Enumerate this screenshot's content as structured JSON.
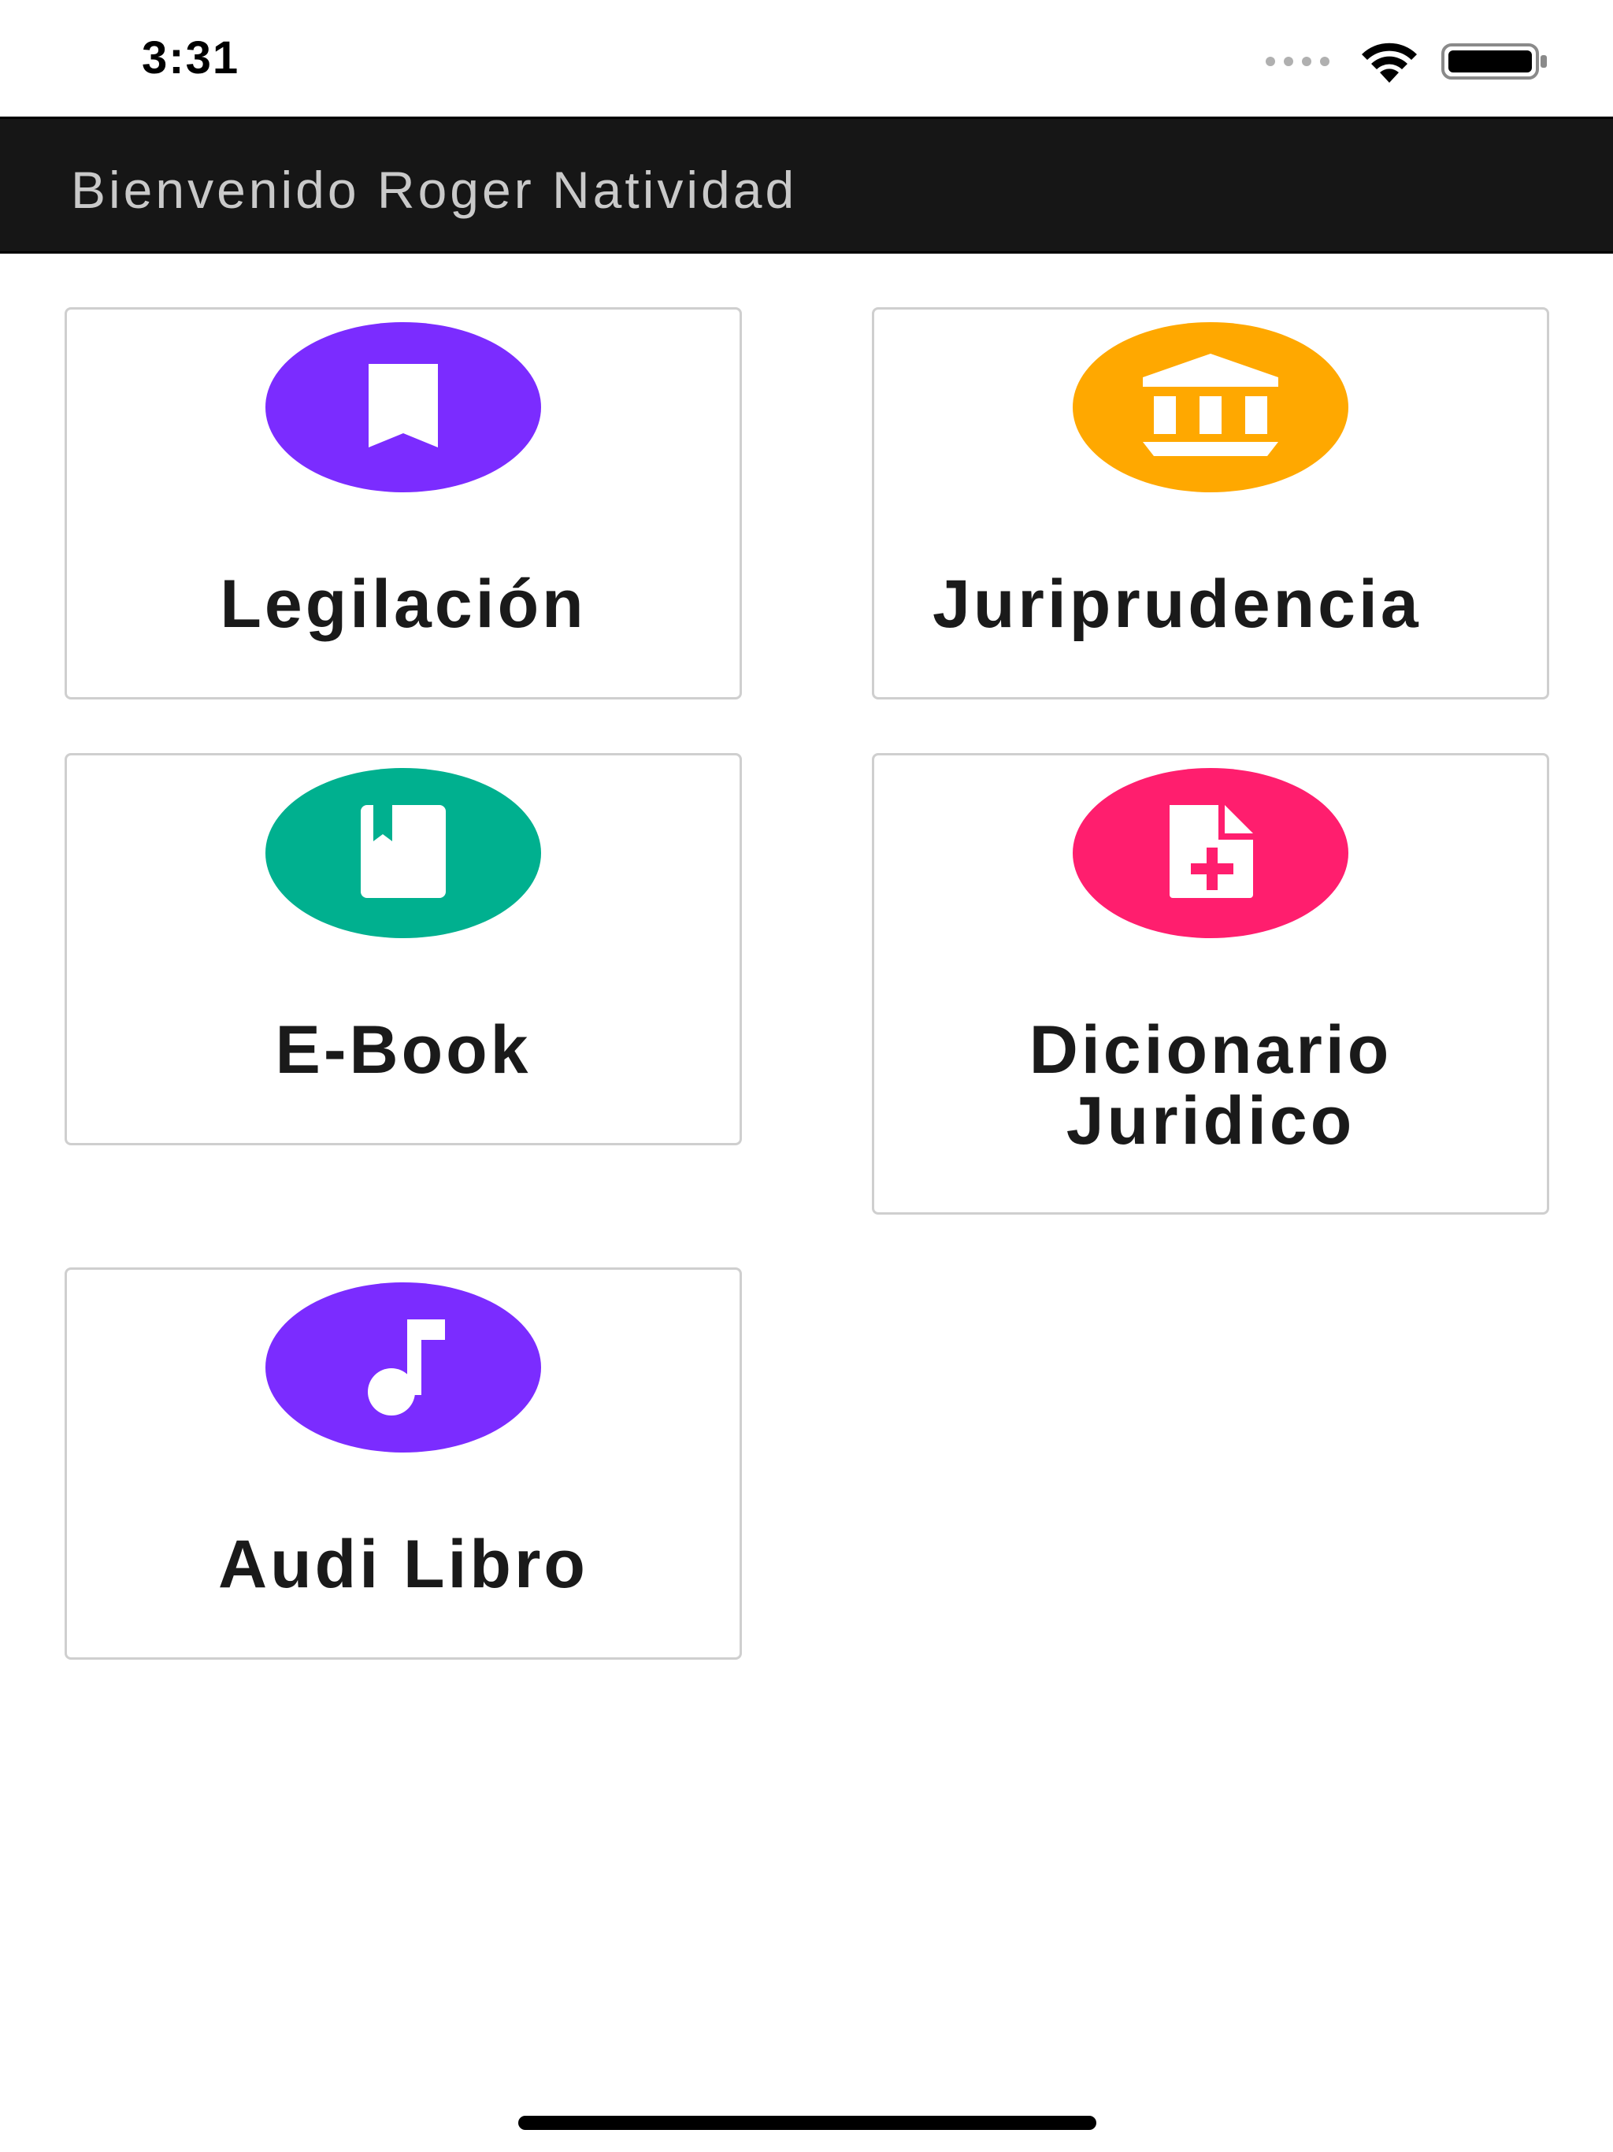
{
  "status_bar": {
    "time": "3:31",
    "icons": [
      "signal-dots-icon",
      "wifi-icon",
      "battery-icon"
    ]
  },
  "header": {
    "title": "Bienvenido Roger Natividad"
  },
  "menu": {
    "items": [
      {
        "label": "Legilación",
        "icon": "bookmark-icon",
        "color": "#7B2CFF"
      },
      {
        "label": "Juriprudencia",
        "icon": "bank-icon",
        "color": "#FFA800"
      },
      {
        "label": "E-Book",
        "icon": "book-icon",
        "color": "#00B08F"
      },
      {
        "label_line1": "Dicionario",
        "label_line2": "Juridico",
        "icon": "document-plus-icon",
        "color": "#FF1E6E"
      },
      {
        "label": "Audi Libro",
        "icon": "music-note-icon",
        "color": "#7B2CFF"
      }
    ]
  },
  "colors": {
    "header_bg": "#161616",
    "header_text": "#c9c9c9",
    "card_border": "#cfcfcf"
  }
}
